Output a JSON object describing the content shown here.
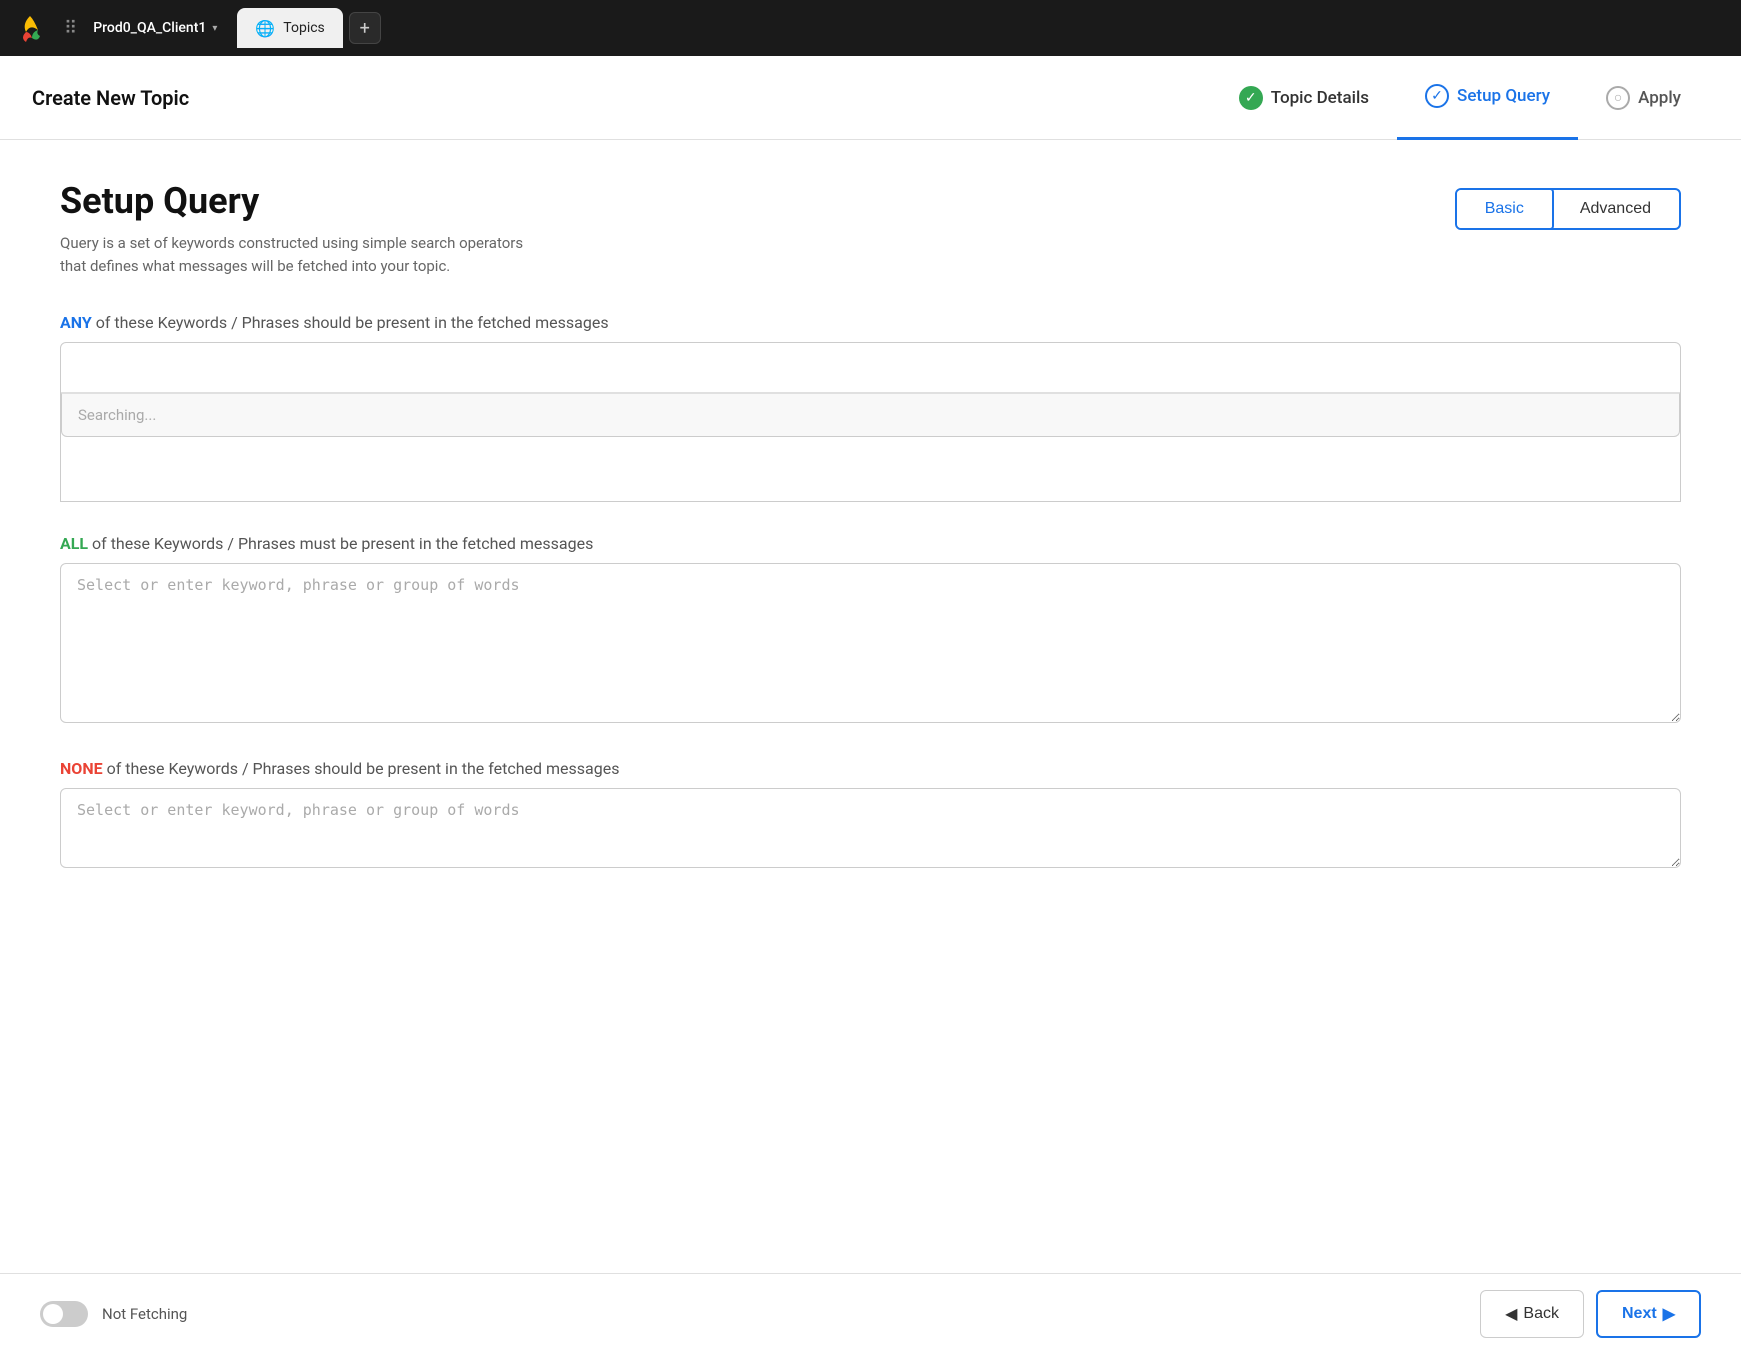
{
  "nav": {
    "logo_alt": "App Logo",
    "account_name": "Prod0_QA_Client1",
    "tab_label": "Topics",
    "add_tab_icon": "+"
  },
  "header": {
    "title": "Create New Topic",
    "steps": [
      {
        "id": "topic-details",
        "label": "Topic Details",
        "icon_type": "green",
        "icon_symbol": "✓"
      },
      {
        "id": "setup-query",
        "label": "Setup Query",
        "icon_type": "blue-outline",
        "icon_symbol": "✓"
      },
      {
        "id": "apply",
        "label": "Apply",
        "icon_type": "gray-outline",
        "icon_symbol": "○"
      }
    ]
  },
  "page": {
    "title": "Setup Query",
    "description_line1": "Query is a set of keywords constructed using simple search operators",
    "description_line2": "that defines what messages will be fetched into your topic.",
    "mode_basic": "Basic",
    "mode_advanced": "Advanced"
  },
  "any_section": {
    "label_keyword": "ANY",
    "label_rest": "of these Keywords / Phrases should be present in the fetched messages",
    "placeholder": "",
    "searching_text": "Searching..."
  },
  "all_section": {
    "label_keyword": "ALL",
    "label_rest": "of these Keywords / Phrases must be present in the fetched messages",
    "placeholder": "Select or enter keyword, phrase or group of words"
  },
  "none_section": {
    "label_keyword": "NONE",
    "label_rest": "of these Keywords / Phrases should be present in the fetched messages",
    "placeholder": "Select or enter keyword, phrase or group of words"
  },
  "footer": {
    "toggle_label": "Not Fetching",
    "back_label": "Back",
    "next_label": "Next"
  }
}
